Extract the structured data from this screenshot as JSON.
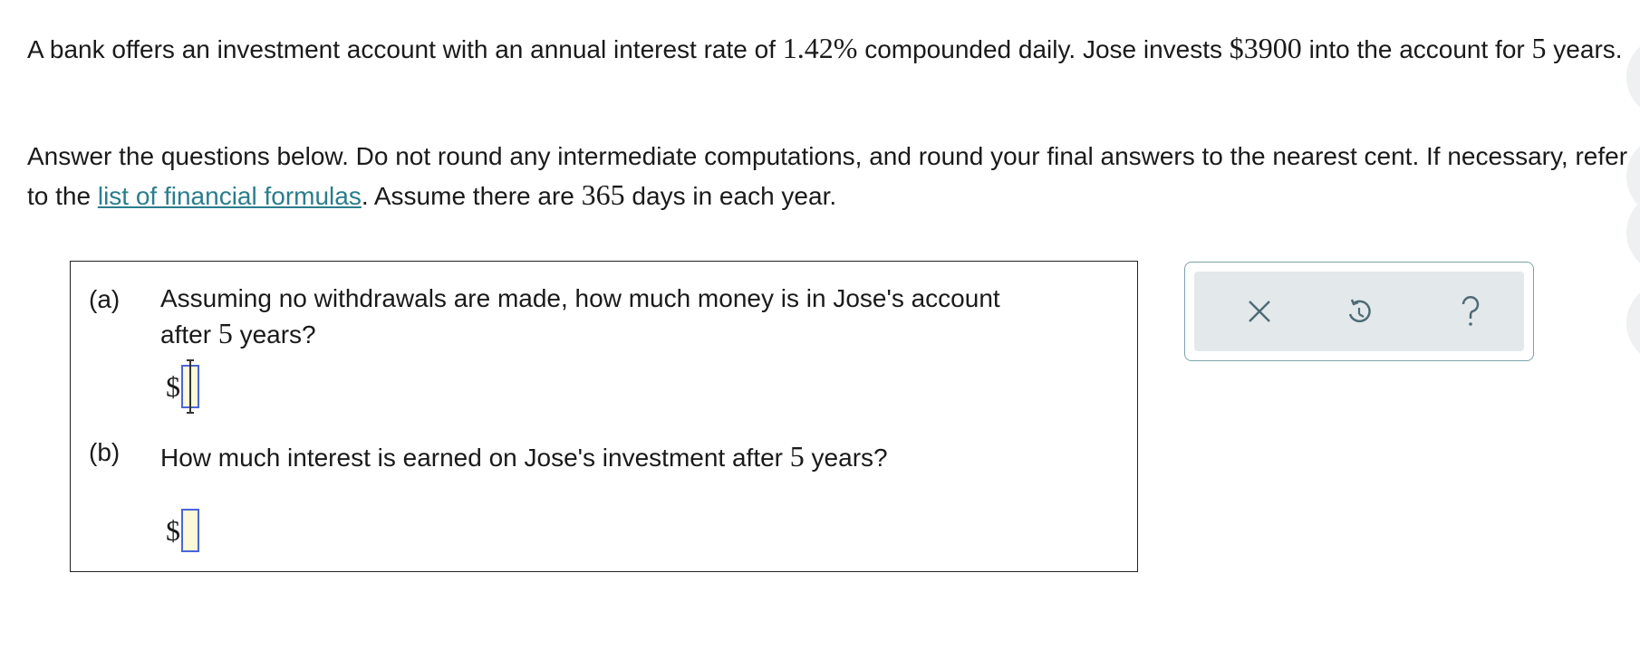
{
  "problem": {
    "p1_a": "A bank offers an investment account with an annual interest rate of ",
    "rate": "1.42%",
    "p1_b": " compounded daily. Jose invests ",
    "principal": "$3900",
    "p1_c": " into the account for ",
    "years": "5",
    "p1_d": " years.",
    "p2_a": "Answer the questions below. Do not round any intermediate computations, and round your final answers to the nearest cent. If necessary, refer to the ",
    "link_text": "list of financial formulas",
    "p2_b": ". Assume there are ",
    "days": "365",
    "p2_c": " days in each year."
  },
  "parts": {
    "a": {
      "label": "(a)",
      "text_line1": "Assuming no withdrawals are made, how much money is in Jose's account",
      "text_line2_a": "after ",
      "years": "5",
      "text_line2_b": " years?",
      "currency": "$",
      "value": ""
    },
    "b": {
      "label": "(b)",
      "text_a": "How much interest is earned on Jose's investment after ",
      "years": "5",
      "text_b": " years?",
      "currency": "$",
      "value": ""
    }
  },
  "toolbar": {
    "clear_icon": "close-icon",
    "undo_icon": "undo-icon",
    "help_icon": "help-icon",
    "icon_color": "#4f6b75",
    "panel_bg": "#e3e8eb",
    "panel_border": "#7aa3a8"
  },
  "colors": {
    "link": "#2a7d8c",
    "input_border": "#4a66d9",
    "input_bg": "#fdf8d8"
  }
}
